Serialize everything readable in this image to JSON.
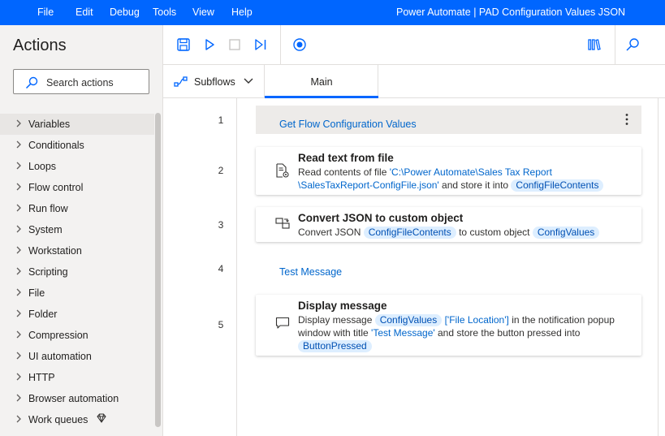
{
  "menu": {
    "file": "File",
    "edit": "Edit",
    "debug": "Debug",
    "tools": "Tools",
    "view": "View",
    "help": "Help"
  },
  "app_title": "Power Automate | PAD Configuration Values JSON",
  "actions_panel": {
    "title": "Actions",
    "search_placeholder": "Search actions",
    "categories": [
      "Variables",
      "Conditionals",
      "Loops",
      "Flow control",
      "Run flow",
      "System",
      "Workstation",
      "Scripting",
      "File",
      "Folder",
      "Compression",
      "UI automation",
      "HTTP",
      "Browser automation",
      "Work queues"
    ]
  },
  "toolbar": {
    "icons": [
      "save-icon",
      "run-icon",
      "stop-icon",
      "run-next-action-icon",
      "record-icon",
      "assets-library-icon",
      "search-icon"
    ]
  },
  "tabs": {
    "subflows": "Subflows",
    "main": "Main"
  },
  "flow": {
    "line_numbers": [
      "1",
      "2",
      "3",
      "4",
      "5"
    ],
    "region_label": "Get Flow Configuration Values",
    "step2": {
      "title": "Read text from file",
      "desc_prefix": "Read contents of file ",
      "file_path_line1": "'C:\\Power Automate\\Sales Tax Report",
      "file_path_line2": "\\SalesTaxReport-ConfigFile.json'",
      "desc_mid": " and store it into ",
      "var": "ConfigFileContents"
    },
    "step3": {
      "title": "Convert JSON to custom object",
      "desc_prefix": "Convert JSON ",
      "var_in": "ConfigFileContents",
      "desc_mid": " to custom object ",
      "var_out": "ConfigValues"
    },
    "comment": "Test Message",
    "step5": {
      "title": "Display message",
      "desc_prefix": "Display message ",
      "var": "ConfigValues",
      "key": "['File Location']",
      "desc_mid": " in the notification popup",
      "line2_prefix": "window with title ",
      "msg_title": "'Test Message'",
      "line2_suffix": " and store the button pressed into",
      "var_out": "ButtonPressed"
    }
  },
  "colors": {
    "title_bar": "#0066ff",
    "accent": "#0066ff",
    "link": "#0066cc",
    "variable_pill": "#ddeeff"
  }
}
